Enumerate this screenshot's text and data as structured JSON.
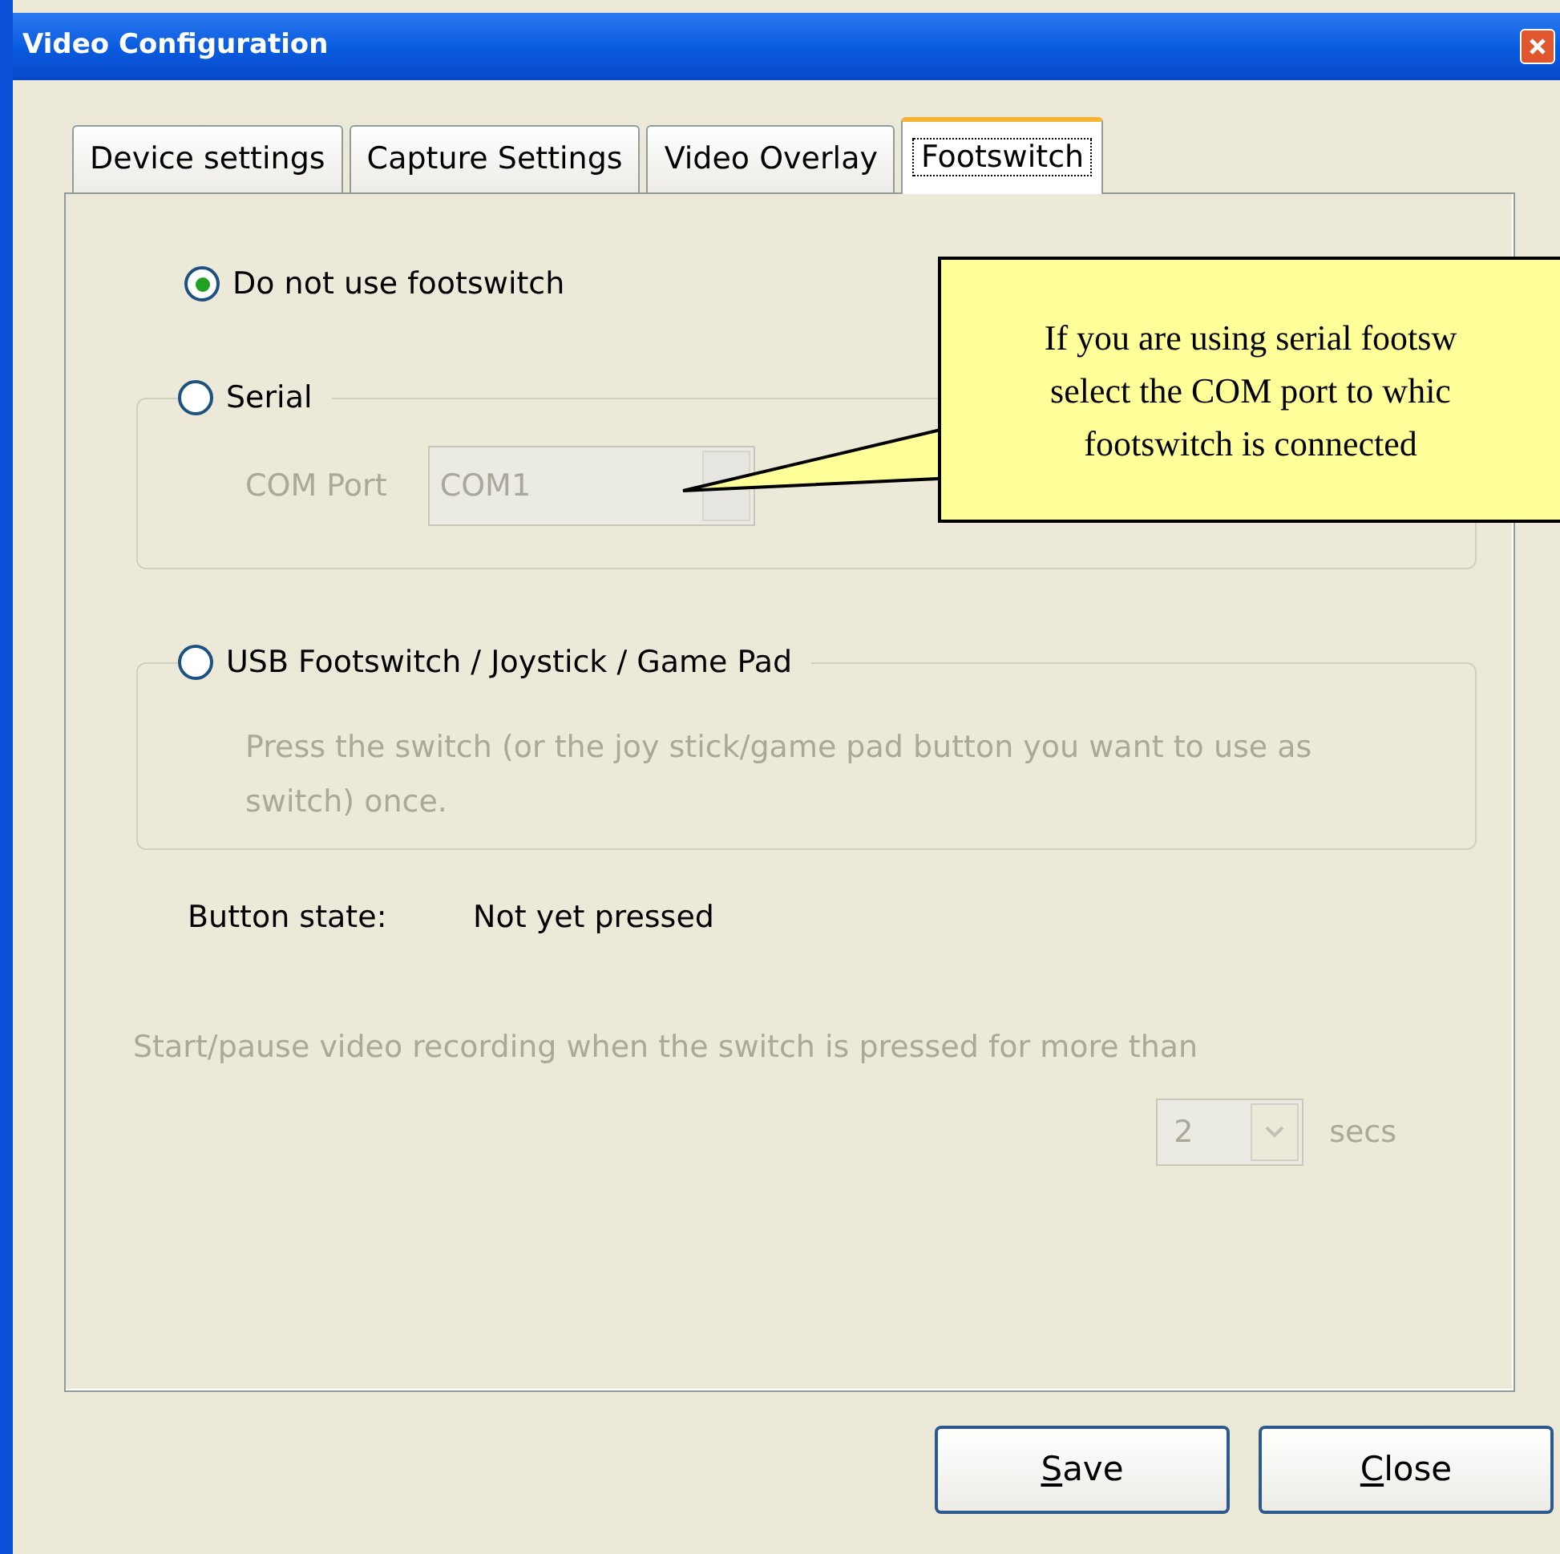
{
  "window": {
    "title": "Video Configuration"
  },
  "tabs": [
    {
      "label": "Device settings",
      "selected": false
    },
    {
      "label": "Capture Settings",
      "selected": false
    },
    {
      "label": "Video Overlay",
      "selected": false
    },
    {
      "label": "Footswitch",
      "selected": true
    }
  ],
  "options": [
    {
      "kind": "plain",
      "label": "Do not use footswitch",
      "selected": true
    },
    {
      "kind": "field",
      "label": "Serial",
      "selected": false,
      "disabled": true,
      "field_label": "COM Port",
      "value": "COM1"
    },
    {
      "kind": "text",
      "label": "USB Footswitch / Joystick / Game Pad",
      "selected": false,
      "disabled": true,
      "description": "Press the switch (or the joy stick/game pad button you want to use as switch) once."
    }
  ],
  "button_state": {
    "label": "Button state:",
    "value": "Not yet pressed"
  },
  "hold": {
    "label": "Start/pause video recording when the switch is pressed for more than",
    "value": "2",
    "unit": "secs",
    "disabled": true
  },
  "callout": {
    "lines": [
      "If you are using serial footsw",
      "select the COM port to whic",
      "footswitch is connected"
    ]
  },
  "buttons": [
    {
      "label": "Save",
      "underline_first": true
    },
    {
      "label": "Close",
      "underline_first": true
    }
  ]
}
